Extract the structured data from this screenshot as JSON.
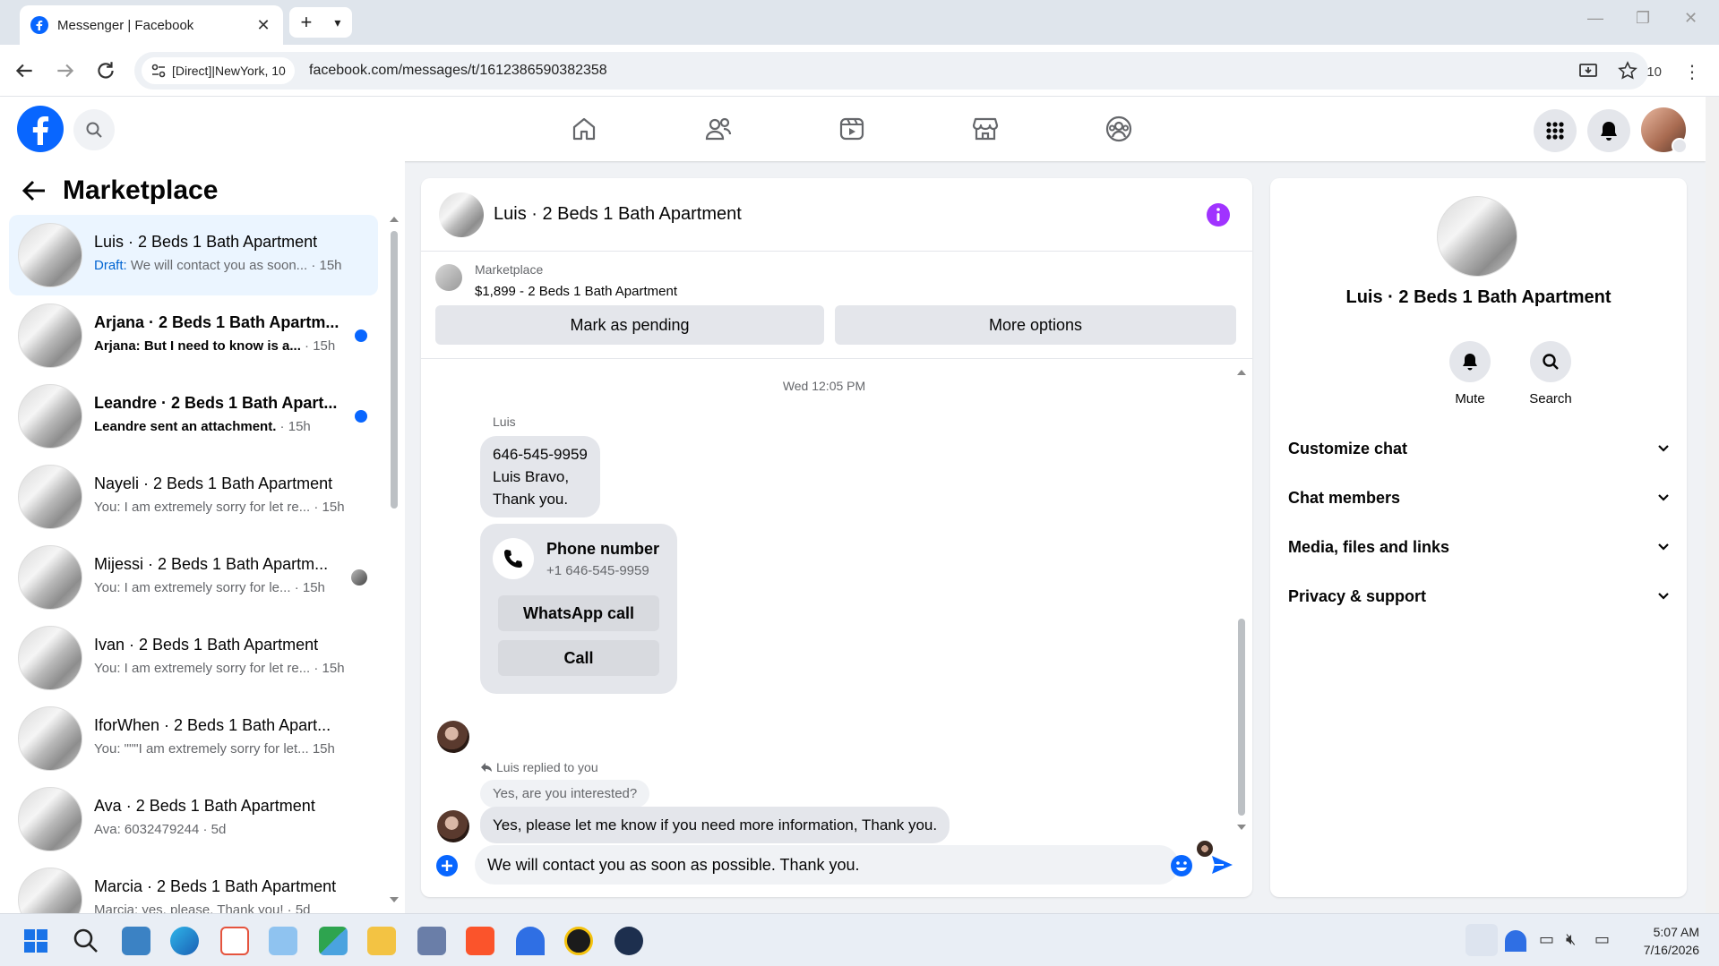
{
  "browser": {
    "tab_title": "Messenger | Facebook",
    "proxy_chip": "[Direct]|NewYork, 10",
    "url": "facebook.com/messages/t/1612386590382358",
    "extension_badge": "10"
  },
  "sidebar": {
    "title": "Marketplace",
    "conversations": [
      {
        "name": "Luis · 2 Beds 1 Bath Apartment",
        "draft_label": "Draft:",
        "preview": " We will contact you as soon...",
        "time": " · 15h"
      },
      {
        "name": "Arjana · 2 Beds 1 Bath Apartm...",
        "preview": "Arjana: But I need to know is a...",
        "time": " · 15h"
      },
      {
        "name": "Leandre · 2 Beds 1 Bath Apart...",
        "preview": "Leandre sent an attachment.",
        "time": " · 15h"
      },
      {
        "name": "Nayeli · 2 Beds 1 Bath Apartment",
        "preview": "You: I am extremely sorry for let re...",
        "time": " · 15h"
      },
      {
        "name": "Mijessi · 2 Beds 1 Bath Apartm...",
        "preview": "You: I am extremely sorry for le...",
        "time": " · 15h"
      },
      {
        "name": "Ivan · 2 Beds 1 Bath Apartment",
        "preview": "You: I am extremely sorry for let re...",
        "time": " · 15h"
      },
      {
        "name": "IforWhen · 2 Beds 1 Bath Apart...",
        "preview": "You: \"\"\"I am extremely sorry for let...",
        "time": " 15h"
      },
      {
        "name": "Ava · 2 Beds 1 Bath Apartment",
        "preview": "Ava: 6032479244",
        "time": " · 5d"
      },
      {
        "name": "Marcia · 2 Beds 1 Bath Apartment",
        "preview": "Marcia: yes, please. Thank you!",
        "time": " · 5d"
      }
    ]
  },
  "chat": {
    "title": "Luis · 2 Beds 1 Bath Apartment",
    "marketplace_label": "Marketplace",
    "listing": "$1,899 - 2 Beds 1 Bath Apartment",
    "mark_pending": "Mark as pending",
    "more_options": "More options",
    "timestamp": "Wed 12:05 PM",
    "sender": "Luis",
    "message1_line1": "646-545-9959",
    "message1_line2": "Luis Bravo,",
    "message1_line3": "Thank you.",
    "card_title": "Phone number",
    "card_number": "+1 646-545-9959",
    "whatsapp_call": "WhatsApp call",
    "call": "Call",
    "reply_note": "Luis replied to you",
    "quoted": "Yes, are you interested?",
    "message2": "Yes, please let me know if you need more information, Thank you.",
    "composer_value": "We will contact you as soon as possible. Thank you."
  },
  "info": {
    "name": "Luis · 2 Beds 1 Bath Apartment",
    "mute": "Mute",
    "search": "Search",
    "sections": [
      "Customize chat",
      "Chat members",
      "Media, files and links",
      "Privacy & support"
    ]
  },
  "taskbar": {
    "time": "5:07 AM",
    "date": "7/16/2026"
  },
  "colors": {
    "fb_blue": "#0866ff",
    "purple_info": "#a033ff",
    "unread_dot": "#0866ff"
  }
}
